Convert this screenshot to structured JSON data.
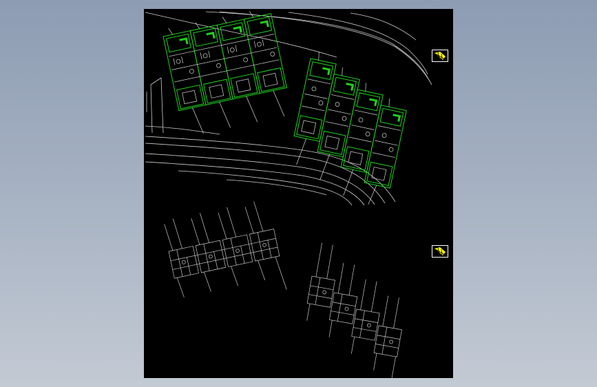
{
  "viewport": {
    "background": "#000000",
    "colors": {
      "road": "#cfcfcf",
      "plan_green": "#1ed21e",
      "plan_white": "#d8d8d8",
      "floor_plan": "#c8c8c8",
      "badge_fill": "#ffff00"
    }
  },
  "icons": {
    "view_badge": "north-arrow-icon"
  }
}
